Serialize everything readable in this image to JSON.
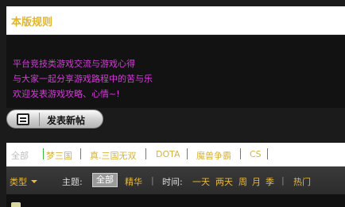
{
  "header": {
    "title": "本版规则"
  },
  "rules": {
    "lines": [
      "平台竞技类游戏交流与游戏心得",
      "与大家一起分享游戏路程中的苦与乐",
      "欢迎发表游戏攻略、心情~!"
    ]
  },
  "post_button": {
    "label": "发表新帖",
    "icon": "document-icon"
  },
  "categories": {
    "items": [
      "全部",
      "梦三国",
      "真.三国无双",
      "DOTA",
      "魔兽争霸",
      "CS"
    ]
  },
  "filter_bar": {
    "type_label": "类型",
    "topic_label": "主题:",
    "topic_all": "全部",
    "topic_best": "精华",
    "pipe": "|",
    "time_label": "时间:",
    "time_options": [
      "一天",
      "两天",
      "周",
      "月",
      "季"
    ],
    "hot": "热门"
  },
  "thread_row": {
    "text": "…………"
  },
  "colors": {
    "accent_gold": "#e0b52a",
    "rules_magenta": "#d43bd8",
    "background": "#1b1b1b"
  }
}
